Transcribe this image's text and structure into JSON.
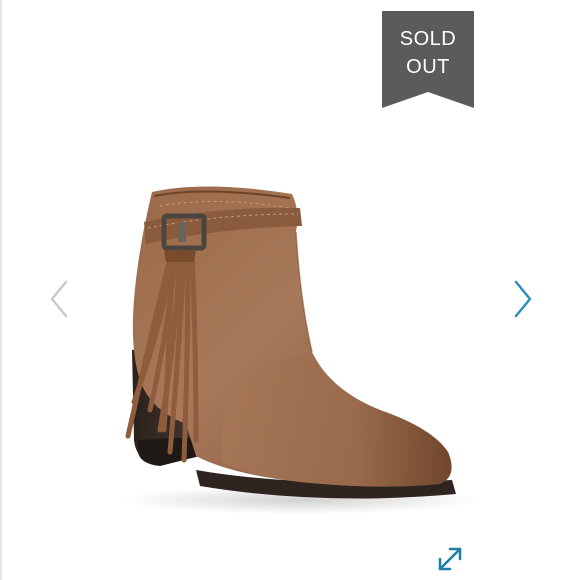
{
  "product": {
    "badge": {
      "line1": "SOLD",
      "line2": "OUT",
      "color": "#5b5b5b"
    },
    "image_subject": "brown-fringe-ankle-boot",
    "controls": {
      "prev_icon": "chevron-left-icon",
      "next_icon": "chevron-right-icon",
      "expand_icon": "expand-diagonal-icon",
      "prev_color": "#c9c9c9",
      "next_color": "#2b8fb8",
      "expand_color": "#1e7fa6"
    }
  }
}
